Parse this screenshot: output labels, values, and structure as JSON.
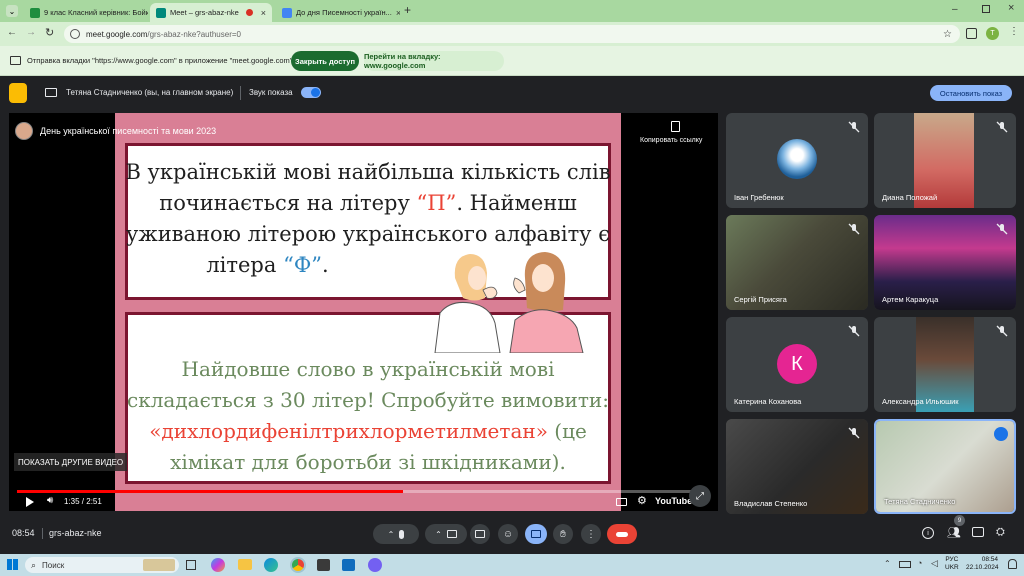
{
  "tabs": [
    {
      "title": "9 клас Класний керівник: Бойк..."
    },
    {
      "title": "Meet – grs-abaz-nke"
    },
    {
      "title": "До дня Писемності україн..."
    }
  ],
  "omnibox": {
    "url_domain": "meet.google.com",
    "url_path": "/grs-abaz-nke?authuser=0"
  },
  "infobar": {
    "message": "Отправка вкладки \"https://www.google.com\" в приложение \"meet.google.com\"...",
    "close_access": "Закрыть доступ",
    "goto_tab": "Перейти на вкладку: www.google.com"
  },
  "presentbar": {
    "presenter": "Тетяна Стадниченко (вы, на главном экране)",
    "sound_label": "Звук показа",
    "stop_button": "Остановить показ"
  },
  "video": {
    "title": "День української писемності та мови 2023",
    "copy_link": "Копировать ссылку",
    "more_videos": "ПОКАЗАТЬ ДРУГИЕ ВИДЕО",
    "time": "1:35 / 2:51",
    "progress": 0.56,
    "youtube": "YouTube"
  },
  "slide": {
    "top_line1_a": "В українській мові найбільша кількість слів",
    "top_line2_a": "починається на літеру ",
    "top_line2_b": "“П”",
    "top_line2_c": ". Найменш",
    "top_line3": "уживаною літерою українського алфавіту є",
    "top_line4_a": "літера ",
    "top_line4_b": "“Ф”",
    "top_line4_c": ".",
    "bottom_line1": "Найдовше слово в українській мові",
    "bottom_line2": "складається з 30 літер! Спробуйте вимовити:",
    "bottom_line3_a": "«дихлордифенілтрихлорметилметан»",
    "bottom_line3_b": " (це",
    "bottom_line4": "хімікат для боротьби зі шкідниками)."
  },
  "participants": [
    {
      "name": "Іван Гребенюк"
    },
    {
      "name": "Диана Положай"
    },
    {
      "name": "Сергій Присяга"
    },
    {
      "name": "Артем Каракуца"
    },
    {
      "name": "Катерина Коханова",
      "initial": "К"
    },
    {
      "name": "Александра Ильюшик"
    },
    {
      "name": "Владислав Степенко"
    },
    {
      "name": "Тетяна Стадниченко"
    }
  ],
  "bottombar": {
    "time": "08:54",
    "meeting_code": "grs-abaz-nke",
    "people_count": "9"
  },
  "taskbar": {
    "search": "Поиск",
    "lang1": "РУС",
    "lang2": "UKR",
    "clock": "08:54",
    "date": "22.10.2024"
  },
  "colors": {
    "accent_red": "#ea4335",
    "slide_pink": "#d97f95",
    "slide_border": "#7b1530",
    "green_text": "#6b8a5e",
    "blue_letter": "#2e86c1"
  }
}
